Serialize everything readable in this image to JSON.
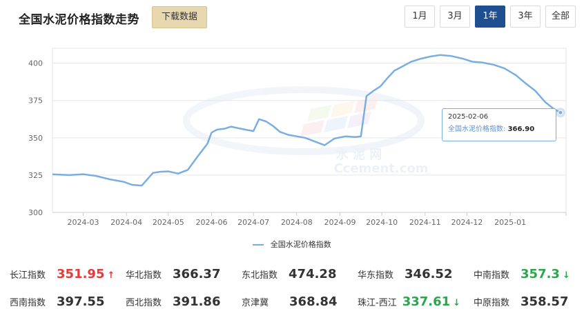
{
  "header": {
    "title": "全国水泥价格指数走势",
    "download_label": "下载数据",
    "ranges": [
      {
        "label": "1月",
        "active": false
      },
      {
        "label": "3月",
        "active": false
      },
      {
        "label": "1年",
        "active": true
      },
      {
        "label": "3年",
        "active": false
      },
      {
        "label": "全部",
        "active": false
      }
    ]
  },
  "chart_data": {
    "type": "line",
    "xlabel": "",
    "ylabel": "",
    "ylim": [
      300,
      410
    ],
    "yticks": [
      300,
      325,
      350,
      375,
      400
    ],
    "xticks": [
      "2024-03",
      "2024-04",
      "2024-05",
      "2024-06",
      "2024-07",
      "2024-08",
      "2024-09",
      "2024-10",
      "2024-11",
      "2024-12",
      "2025-01"
    ],
    "grid": true,
    "legend_position": "bottom",
    "series": [
      {
        "name": "全国水泥价格指数",
        "color": "#7aaee0",
        "x": [
          "2024-02-08",
          "2024-02-20",
          "2024-03-01",
          "2024-03-10",
          "2024-03-20",
          "2024-03-30",
          "2024-04-05",
          "2024-04-12",
          "2024-04-20",
          "2024-04-25",
          "2024-05-01",
          "2024-05-08",
          "2024-05-15",
          "2024-05-22",
          "2024-05-29",
          "2024-06-01",
          "2024-06-05",
          "2024-06-10",
          "2024-06-15",
          "2024-06-20",
          "2024-06-25",
          "2024-07-01",
          "2024-07-05",
          "2024-07-10",
          "2024-07-15",
          "2024-07-20",
          "2024-07-26",
          "2024-08-01",
          "2024-08-07",
          "2024-08-14",
          "2024-08-21",
          "2024-08-28",
          "2024-09-05",
          "2024-09-12",
          "2024-09-16",
          "2024-09-20",
          "2024-09-25",
          "2024-09-30",
          "2024-10-05",
          "2024-10-10",
          "2024-10-16",
          "2024-10-22",
          "2024-10-29",
          "2024-11-05",
          "2024-11-12",
          "2024-11-20",
          "2024-11-28",
          "2024-12-05",
          "2024-12-12",
          "2024-12-20",
          "2024-12-28",
          "2025-01-05",
          "2025-01-12",
          "2025-01-19",
          "2025-01-26",
          "2025-02-01",
          "2025-02-06"
        ],
        "values": [
          325.5,
          325.0,
          325.6,
          324.5,
          322.2,
          320.5,
          318.5,
          318.0,
          326.5,
          327.2,
          327.5,
          326.0,
          328.5,
          337.5,
          346.0,
          353.5,
          355.5,
          356.0,
          357.5,
          356.5,
          355.5,
          354.5,
          362.5,
          361.0,
          358.0,
          354.0,
          352.0,
          351.0,
          350.0,
          347.5,
          345.0,
          349.5,
          351.0,
          350.5,
          351.0,
          378.0,
          381.5,
          384.5,
          390.0,
          395.0,
          398.0,
          401.0,
          403.0,
          404.5,
          405.5,
          404.8,
          403.0,
          401.0,
          400.5,
          399.0,
          396.5,
          392.0,
          386.5,
          381.5,
          374.0,
          369.5,
          366.9
        ]
      }
    ]
  },
  "tooltip": {
    "date": "2025-02-06",
    "series_name": "全国水泥价格指数:",
    "value": "366.90"
  },
  "indices": [
    [
      {
        "name": "长江指数",
        "value": "351.95",
        "trend": "up"
      },
      {
        "name": "华北指数",
        "value": "366.37",
        "trend": "none"
      },
      {
        "name": "东北指数",
        "value": "474.28",
        "trend": "none"
      },
      {
        "name": "华东指数",
        "value": "346.52",
        "trend": "none"
      },
      {
        "name": "中南指数",
        "value": "357.3",
        "trend": "down"
      }
    ],
    [
      {
        "name": "西南指数",
        "value": "397.55",
        "trend": "none"
      },
      {
        "name": "西北指数",
        "value": "391.86",
        "trend": "none"
      },
      {
        "name": "京津冀",
        "value": "368.84",
        "trend": "none"
      },
      {
        "name": "珠江-西江",
        "value": "337.61",
        "trend": "down"
      },
      {
        "name": "中原指数",
        "value": "358.57",
        "trend": "none"
      }
    ]
  ],
  "watermark": {
    "text1": "水 泥 网",
    "text2": "Ccement.com"
  },
  "colors": {
    "accent": "#1d4f91",
    "line": "#7aaee0",
    "up": "#e03c3c",
    "down": "#2da44e"
  }
}
